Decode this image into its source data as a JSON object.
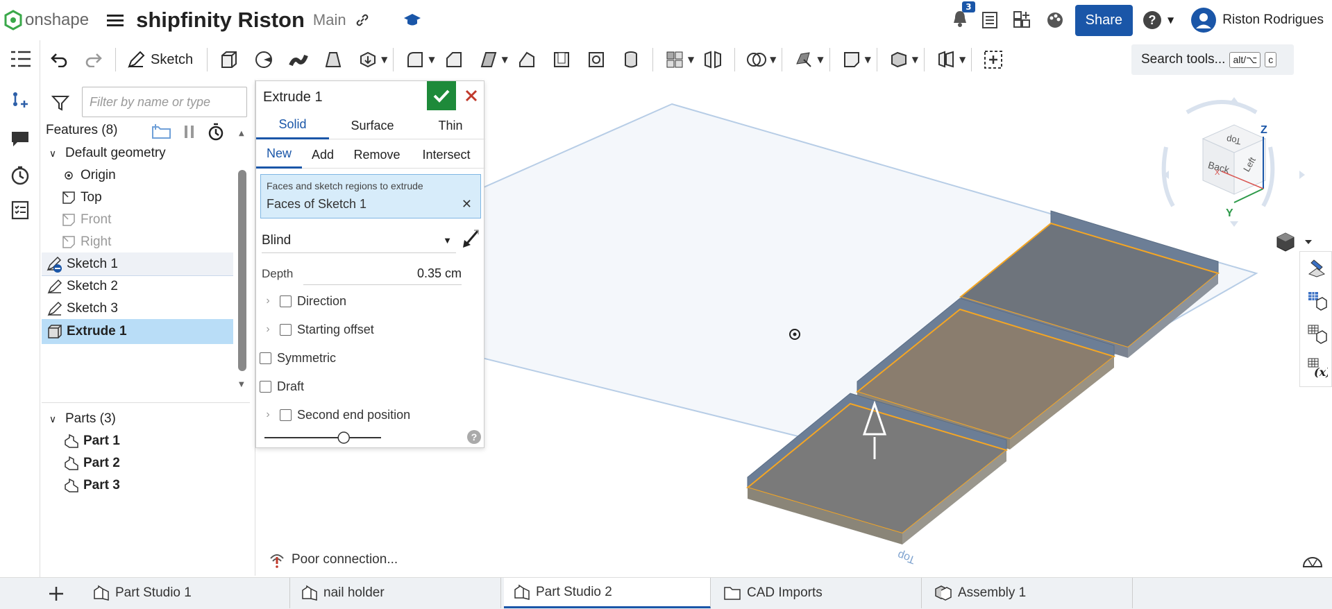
{
  "app": {
    "logo_text": "onshape",
    "doc_title": "shipfinity Riston",
    "branch": "Main"
  },
  "topbar": {
    "notification_count": "3",
    "share_label": "Share",
    "user_name": "Riston Rodrigues"
  },
  "toolbar": {
    "sketch_label": "Sketch",
    "search_label": "Search tools...",
    "shortcut_1": "alt/⌥",
    "shortcut_2": "c"
  },
  "feature_panel": {
    "filter_placeholder": "Filter by name or type",
    "features_header": "Features (8)",
    "default_geometry": "Default geometry",
    "items": [
      "Origin",
      "Top",
      "Front",
      "Right",
      "Sketch 1",
      "Sketch 2",
      "Sketch 3",
      "Extrude 1"
    ],
    "parts_header": "Parts (3)",
    "parts": [
      "Part 1",
      "Part 2",
      "Part 3"
    ]
  },
  "extrude_dialog": {
    "title": "Extrude 1",
    "type_tabs": [
      "Solid",
      "Surface",
      "Thin"
    ],
    "op_tabs": [
      "New",
      "Add",
      "Remove",
      "Intersect"
    ],
    "selection_caption": "Faces and sketch regions to extrude",
    "selection_value": "Faces of Sketch 1",
    "end_type": "Blind",
    "depth_label": "Depth",
    "depth_value": "0.35 cm",
    "options": [
      "Direction",
      "Starting offset",
      "Symmetric",
      "Draft",
      "Second end position"
    ],
    "slider_fraction": 0.68
  },
  "viewport": {
    "status_text": "Poor connection...",
    "top_plane_label": "Top",
    "cube_labels": [
      "Top",
      "Back",
      "Left"
    ],
    "axis_labels": [
      "Z",
      "Y",
      "X"
    ]
  },
  "bottom_tabs": [
    "Part Studio 1",
    "nail holder",
    "Part Studio 2",
    "CAD Imports",
    "Assembly 1"
  ],
  "colors": {
    "accent": "#1a56a8",
    "confirm": "#1e8a3a",
    "cancel": "#c0392b",
    "selection_edge": "#f5a623"
  }
}
